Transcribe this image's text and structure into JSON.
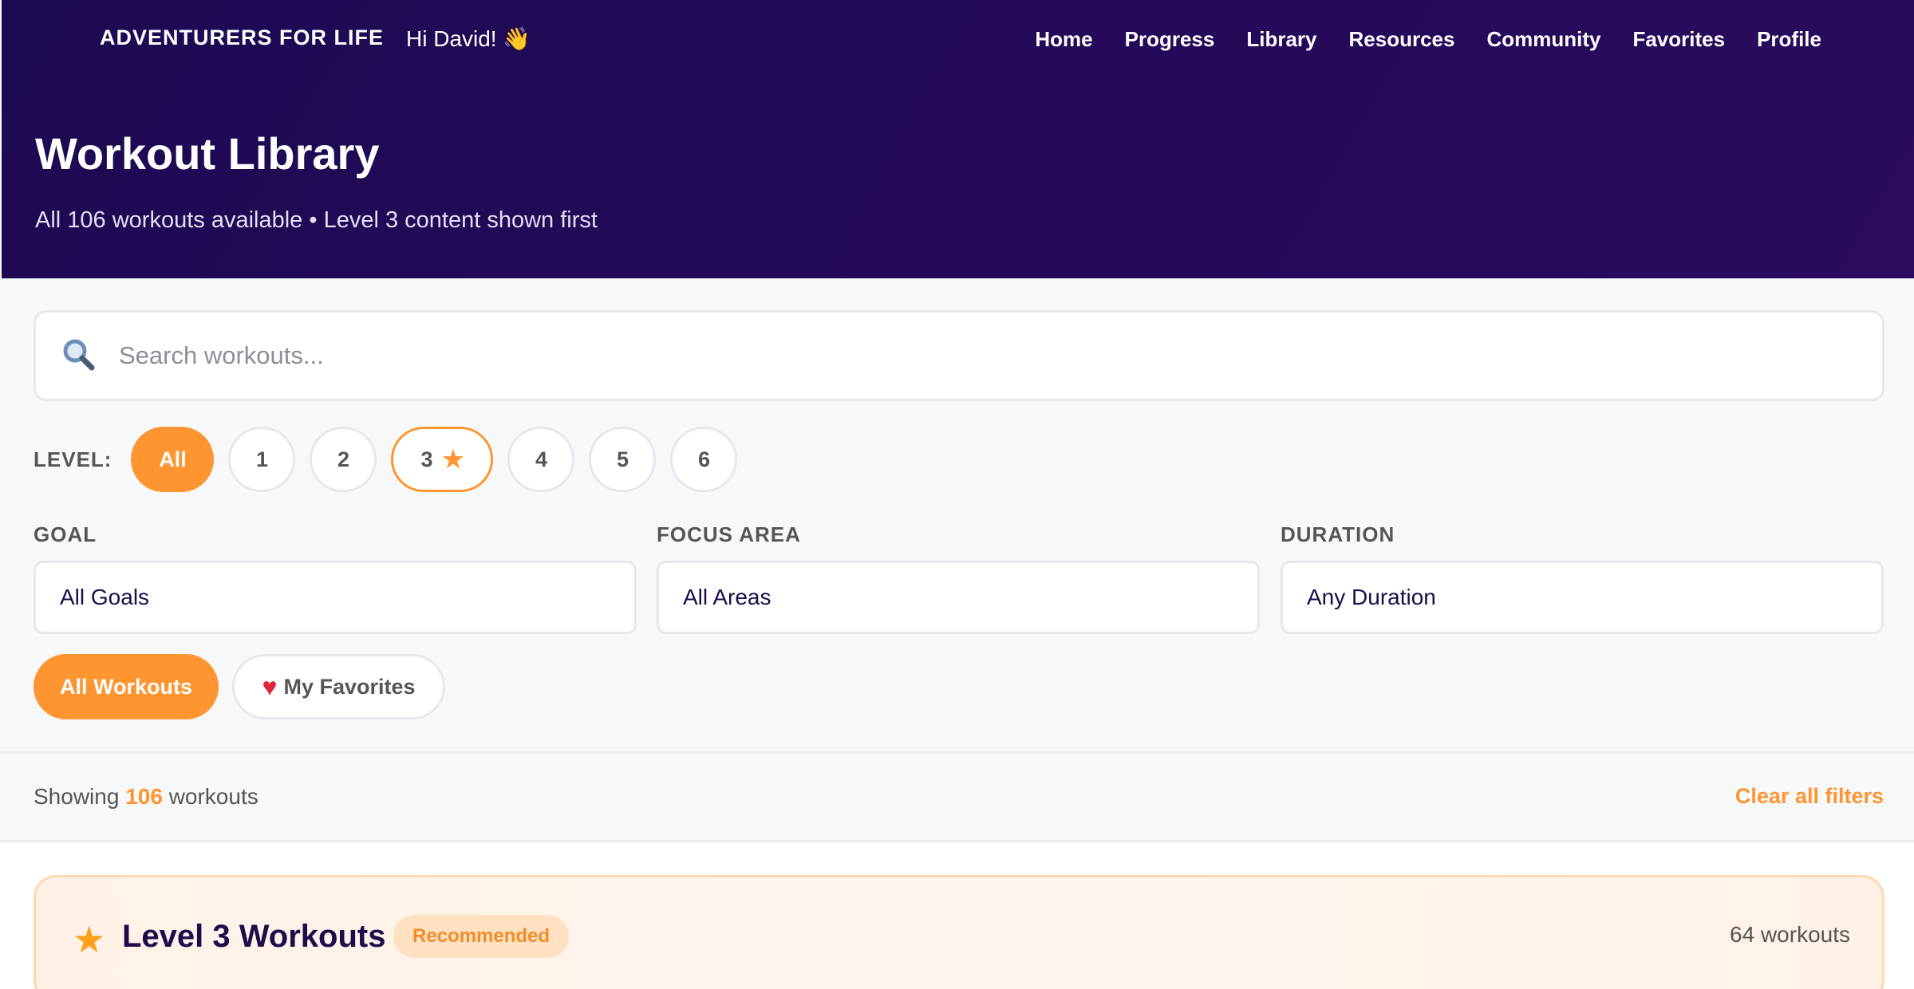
{
  "header": {
    "brand": "ADVENTURERS FOR LIFE",
    "greeting": "Hi David! 👋",
    "nav": [
      "Home",
      "Progress",
      "Library",
      "Resources",
      "Community",
      "Favorites",
      "Profile"
    ],
    "title": "Workout Library",
    "subtitle": "All 106 workouts available • Level 3 content shown first"
  },
  "search": {
    "placeholder": "Search workouts...",
    "value": "",
    "icon": "search-icon"
  },
  "level_filter": {
    "label": "LEVEL:",
    "options": [
      "All",
      "1",
      "2",
      "3",
      "4",
      "5",
      "6"
    ],
    "selected": "All",
    "recommended": "3",
    "recommended_icon": "★"
  },
  "filters": {
    "goal": {
      "label": "GOAL",
      "value": "All Goals"
    },
    "focus_area": {
      "label": "FOCUS AREA",
      "value": "All Areas"
    },
    "duration": {
      "label": "DURATION",
      "value": "Any Duration"
    }
  },
  "view_toggle": {
    "all_label": "All Workouts",
    "favorites_label": "My Favorites",
    "favorites_icon": "♥",
    "selected": "All Workouts"
  },
  "results": {
    "showing_prefix": "Showing",
    "count": "106",
    "showing_suffix": "workouts",
    "clear_label": "Clear all filters"
  },
  "section": {
    "star": "★",
    "title": "Level 3 Workouts",
    "badge": "Recommended",
    "count": "64 workouts"
  },
  "colors": {
    "header_bg": "#1c0a52",
    "accent": "#ff9530",
    "section_bg": "#fff1e6",
    "heart": "#e0253b"
  }
}
